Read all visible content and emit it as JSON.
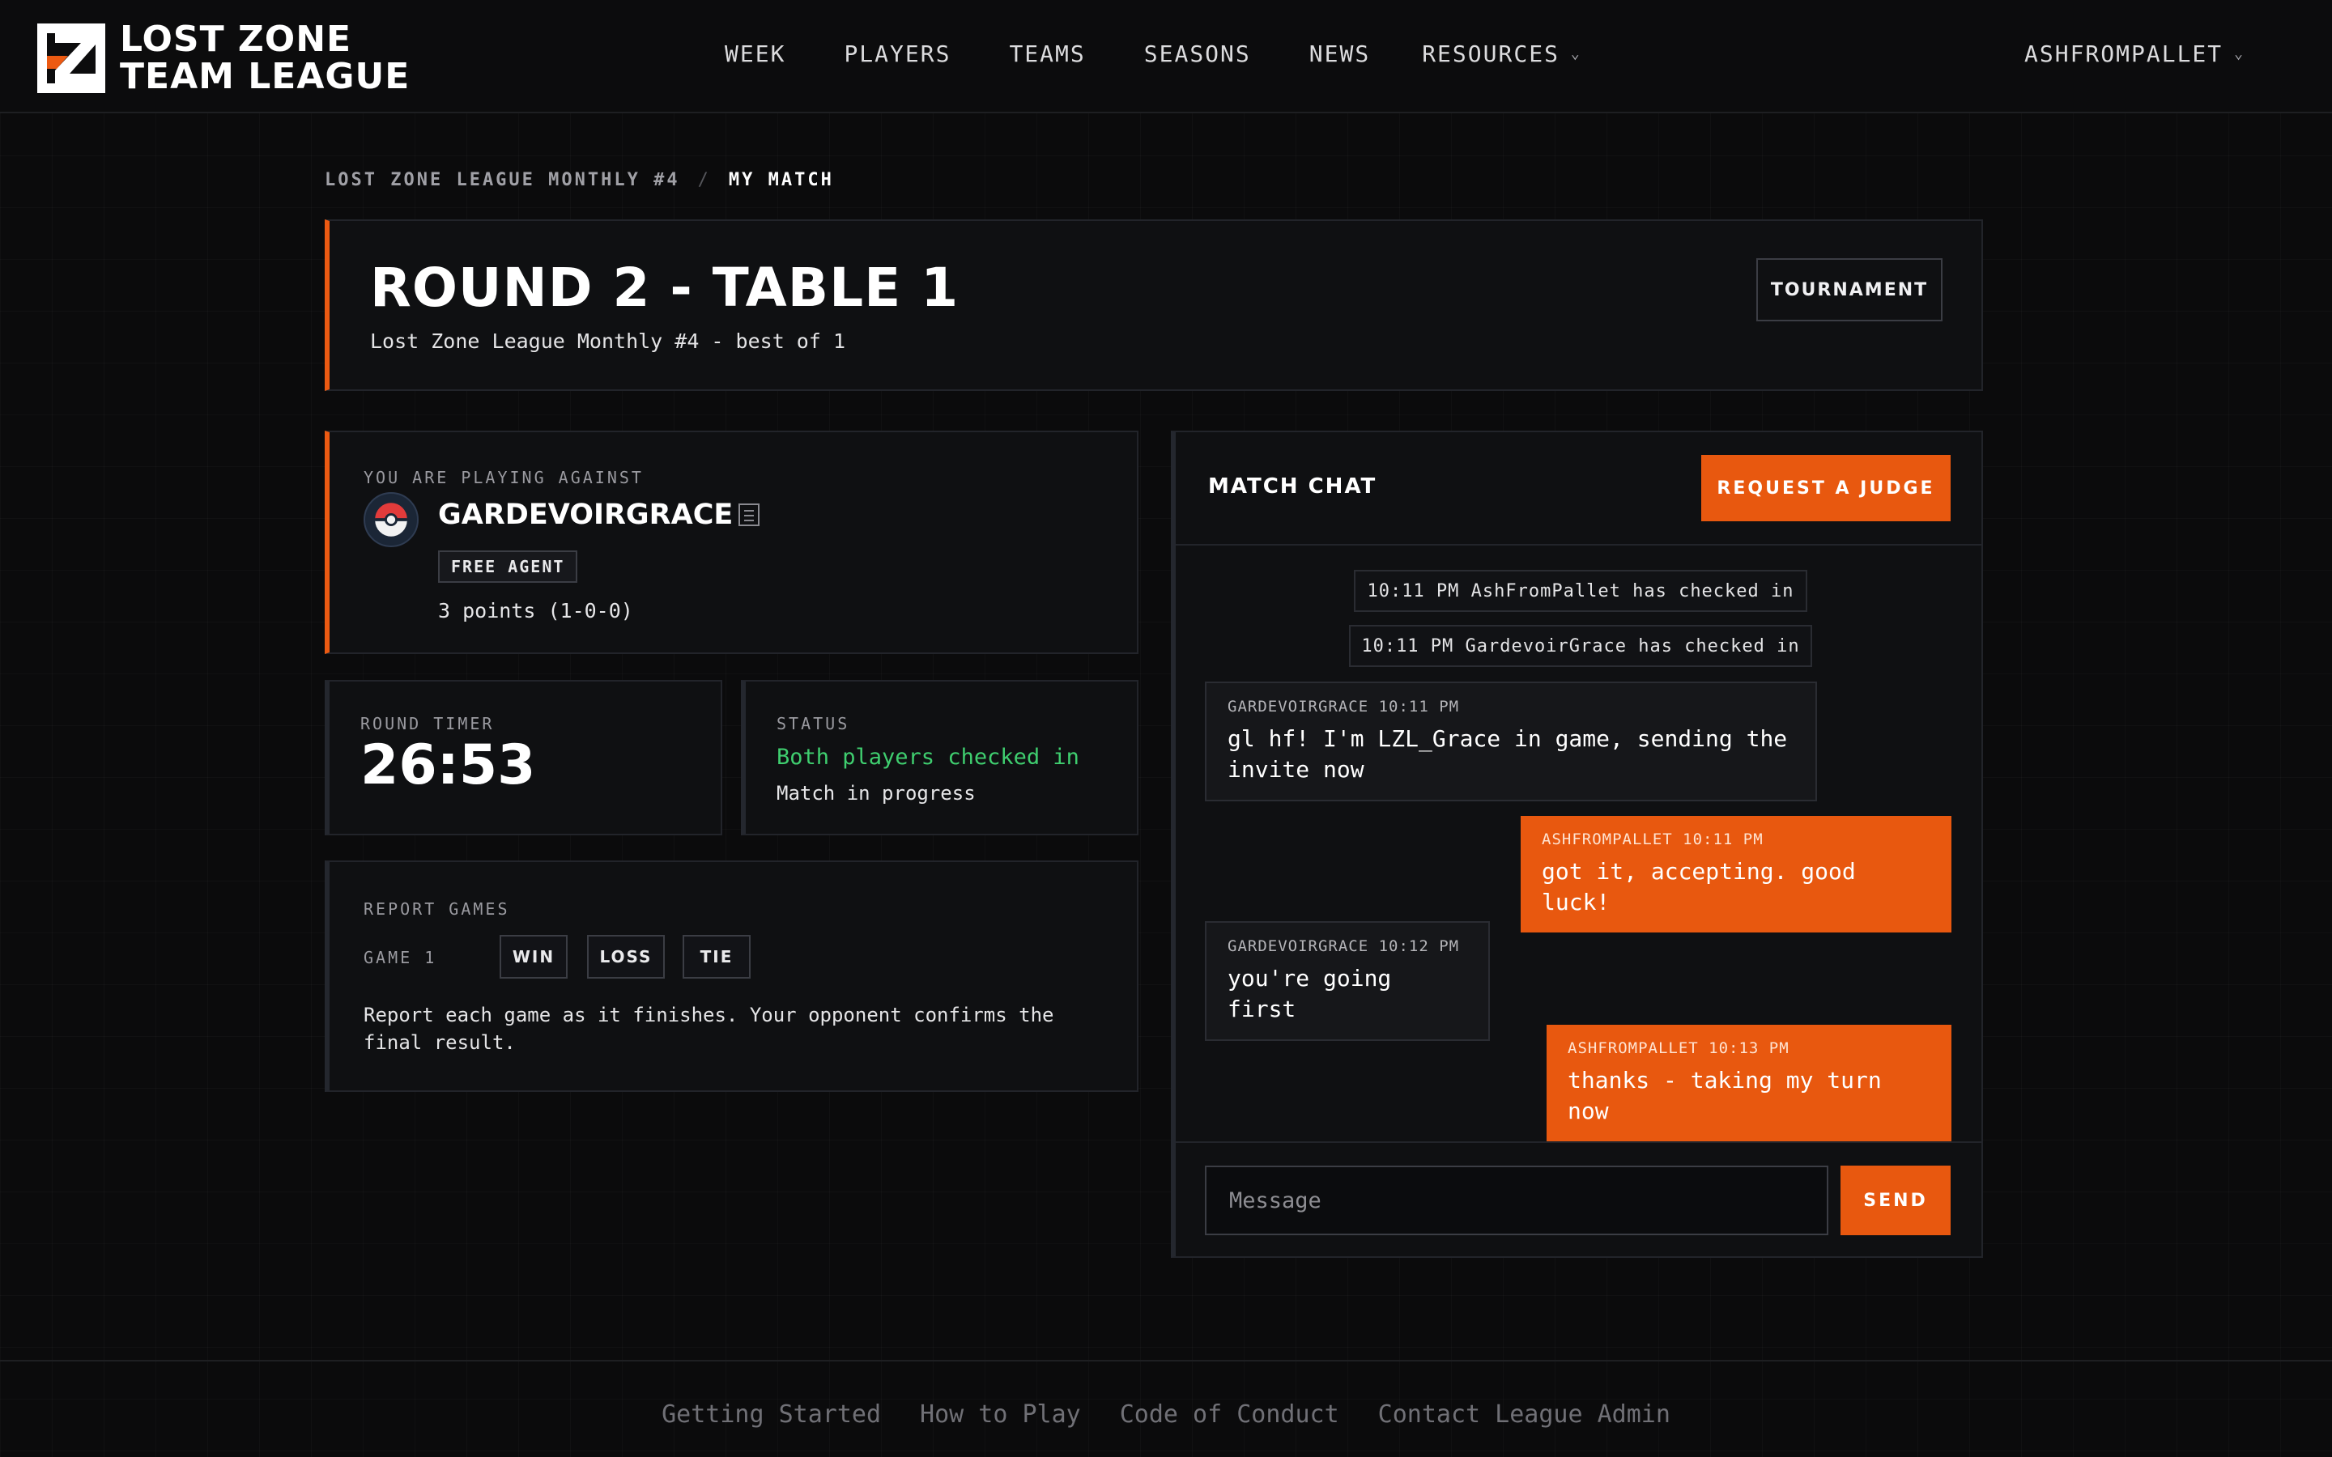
{
  "brand": {
    "line1": "LOST ZONE",
    "line2": "TEAM LEAGUE",
    "accent": "#ec5a12"
  },
  "nav": {
    "items": [
      "WEEK",
      "PLAYERS",
      "TEAMS",
      "SEASONS",
      "NEWS"
    ],
    "resources_label": "RESOURCES",
    "user": "ASHFROMPALLET"
  },
  "breadcrumb": {
    "parent": "LOST ZONE LEAGUE MONTHLY #4",
    "separator": "/",
    "current": "MY MATCH"
  },
  "header": {
    "title": "ROUND 2 - TABLE 1",
    "subtitle": "Lost Zone League Monthly #4 - best of 1",
    "tournament_button": "TOURNAMENT"
  },
  "opponent": {
    "label": "YOU ARE PLAYING AGAINST",
    "name": "GARDEVOIRGRACE",
    "tag": "FREE AGENT",
    "points": "3 points (1-0-0)"
  },
  "timer": {
    "label": "ROUND TIMER",
    "value": "26:53"
  },
  "status": {
    "label": "STATUS",
    "primary": "Both players checked in",
    "secondary": "Match in progress",
    "primary_color": "#3fce6f"
  },
  "report": {
    "label": "REPORT GAMES",
    "game_label": "GAME 1",
    "win": "WIN",
    "loss": "LOSS",
    "tie": "TIE",
    "note": "Report each game as it finishes. Your opponent confirms the final result."
  },
  "chat": {
    "title": "MATCH CHAT",
    "judge_button": "REQUEST A JUDGE",
    "system": [
      "10:11 PM AshFromPallet has checked in",
      "10:11 PM GardevoirGrace has checked in"
    ],
    "messages": [
      {
        "meta": "GARDEVOIRGRACE 10:11 PM",
        "text": "gl hf! I'm LZL_Grace in game, sending the invite now"
      },
      {
        "meta": "ASHFROMPALLET 10:11 PM",
        "text": "got it, accepting. good luck!"
      },
      {
        "meta": "GARDEVOIRGRACE 10:12 PM",
        "text": "you're going first"
      },
      {
        "meta": "ASHFROMPALLET 10:13 PM",
        "text": "thanks - taking my turn now"
      }
    ],
    "input_placeholder": "Message",
    "send": "SEND"
  },
  "footer": {
    "links": [
      "Getting Started",
      "How to Play",
      "Code of Conduct",
      "Contact League Admin"
    ]
  }
}
